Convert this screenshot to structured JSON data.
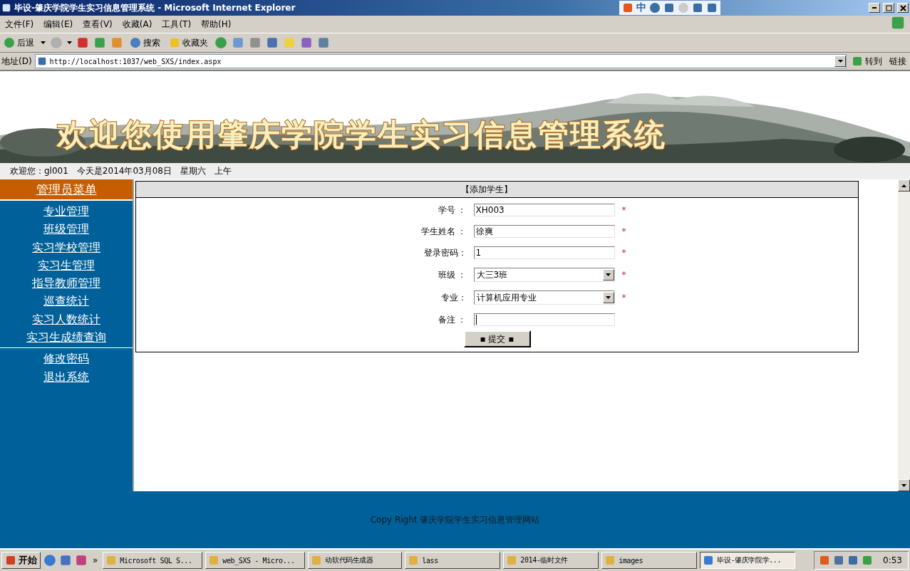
{
  "window": {
    "title": "毕设-肇庆学院学生实习信息管理系统 - Microsoft Internet Explorer"
  },
  "ime_bar": {
    "items": [
      "中"
    ]
  },
  "menu": [
    "文件(F)",
    "编辑(E)",
    "查看(V)",
    "收藏(A)",
    "工具(T)",
    "帮助(H)"
  ],
  "toolbar": {
    "back": "后退",
    "search": "搜索",
    "favorites": "收藏夹"
  },
  "address": {
    "label": "地址(D)",
    "url": "http://localhost:1037/web_SXS/index.aspx",
    "go": "转到",
    "links": "链接"
  },
  "banner": {
    "title": "欢迎您使用肇庆学院学生实习信息管理系统"
  },
  "info_bar": [
    "欢迎您：gl001",
    "今天是2014年03月08日",
    "星期六",
    "上午"
  ],
  "sidebar": {
    "title": "管理员菜单",
    "groups": [
      [
        "专业管理",
        "班级管理",
        "实习学校管理",
        "实习生管理",
        "指导教师管理",
        "巡查统计",
        "实习人数统计",
        "实习生成绩查询"
      ],
      [
        "修改密码",
        "退出系统"
      ]
    ]
  },
  "form": {
    "title": "【添加学生】",
    "fields": [
      {
        "kind": "text",
        "label": "学号 ：",
        "value": "XH003",
        "required": true
      },
      {
        "kind": "text",
        "label": "学生姓名 ：",
        "value": "徐爽",
        "required": true
      },
      {
        "kind": "text",
        "label": "登录密码：",
        "value": "1",
        "required": true
      },
      {
        "kind": "select",
        "label": "班级 ：",
        "value": "大三3班",
        "required": true
      },
      {
        "kind": "select",
        "label": "专业：",
        "value": "计算机应用专业",
        "required": true
      },
      {
        "kind": "text",
        "label": "备注 ：",
        "required": false
      }
    ],
    "required_mark": "*",
    "submit": "▪ 提交 ▪"
  },
  "footer": "Copy Right 肇庆学院学生实习信息管理网站",
  "taskbar": {
    "start": "开始",
    "more": "»",
    "tasks": [
      {
        "label": "Microsoft SQL S...",
        "selected": false
      },
      {
        "label": "web_SXS - Micro...",
        "selected": false
      },
      {
        "label": "动软代码生成器",
        "selected": false
      },
      {
        "label": "lass",
        "selected": false
      },
      {
        "label": "2014-临时文件",
        "selected": false
      },
      {
        "label": "images",
        "selected": false
      },
      {
        "label": "毕设-肇庆学院学...",
        "selected": true
      }
    ],
    "clock": "0:53"
  }
}
